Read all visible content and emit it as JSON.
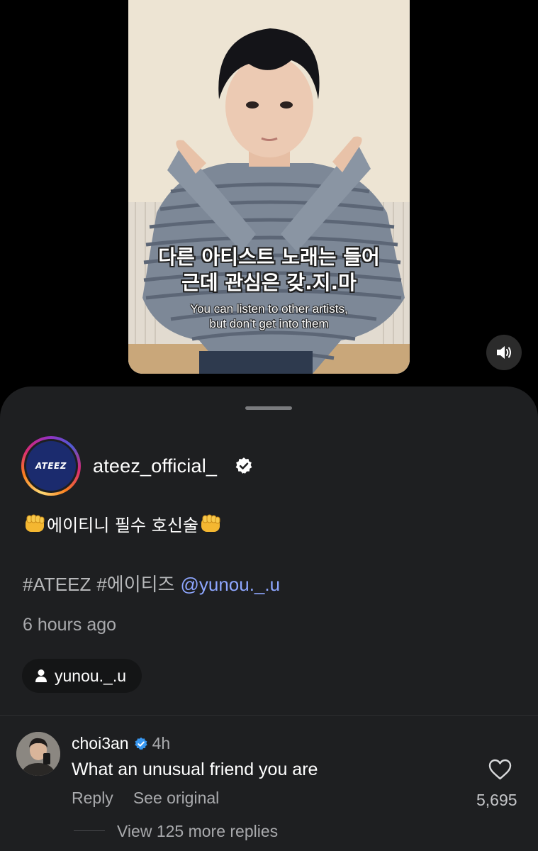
{
  "video": {
    "subtitle_ko_line1": "다른 아티스트 노래는 들어",
    "subtitle_ko_line2": "근데 관심은 갖.지.마",
    "subtitle_en_line1": "You can listen to other artists,",
    "subtitle_en_line2": "but don’t get into them",
    "mute_icon": "speaker-icon"
  },
  "post": {
    "avatar_text": "ATEEZ",
    "username": "ateez_official_",
    "verified_icon": "verified-badge-icon",
    "caption": "에이티니 필수 호신술",
    "caption_emoji": "fist-icon",
    "hashtags": [
      "#ATEEZ",
      "#에이티즈"
    ],
    "mention": "@yunou._.u",
    "time_ago": "6 hours ago",
    "tagged_user": "yunou._.u"
  },
  "comment": {
    "username": "choi3an",
    "time": "4h",
    "text": "What an unusual friend you are",
    "reply_label": "Reply",
    "see_original_label": "See original",
    "likes": "5,695",
    "view_replies": "View 125 more replies"
  },
  "colors": {
    "background": "#000000",
    "sheet": "#1e1f21",
    "mention": "#8ea6ff",
    "verified": "#3897f0"
  }
}
